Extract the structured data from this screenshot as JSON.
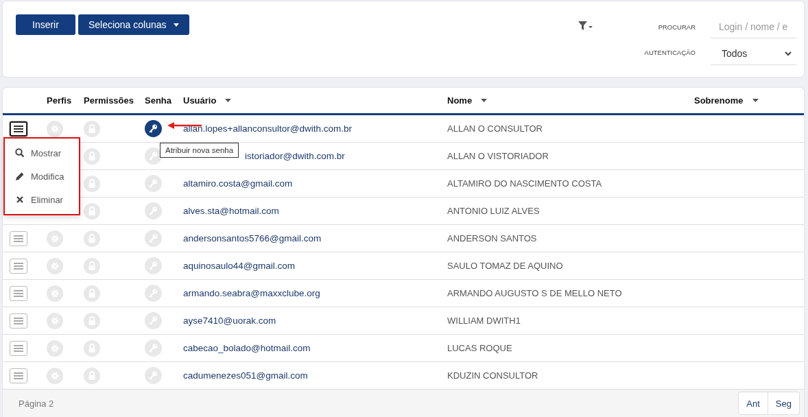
{
  "toolbar": {
    "buttons": [
      {
        "label": "Inserir",
        "kind": "plain"
      },
      {
        "label": "Seleciona colunas",
        "kind": "dropdown"
      }
    ],
    "filters": [
      {
        "label": "PROCURAR",
        "kind": "text",
        "placeholder": "Login / nome / e"
      },
      {
        "label": "AUTENTICAÇÃO",
        "kind": "select",
        "value": "Todos"
      }
    ]
  },
  "table": {
    "columns": [
      {
        "label": "Perfis",
        "sortable": false
      },
      {
        "label": "Permissões",
        "sortable": false
      },
      {
        "label": "Senha",
        "sortable": false
      },
      {
        "label": "Usuário",
        "sortable": true
      },
      {
        "label": "Nome",
        "sortable": true
      },
      {
        "label": "Sobrenome",
        "sortable": true
      }
    ],
    "rows": [
      {
        "usuario": "allan.lopes+allanconsultor@dwith.com.br",
        "nome": "ALLAN O CONSULTOR",
        "key_highlighted": true,
        "key_tooltip": "Atribuir nova senha",
        "row_menu": [
          {
            "label": "Mostrar",
            "kind": "view"
          },
          {
            "label": "Modifica",
            "kind": "edit"
          },
          {
            "label": "Eliminar",
            "kind": "delete"
          }
        ]
      },
      {
        "usuario": "istoriador@dwith.com.br",
        "nome": "ALLAN O VISTORIADOR",
        "key_highlighted": false
      },
      {
        "usuario": "altamiro.costa@gmail.com",
        "nome": "ALTAMIRO DO NASCIMENTO COSTA",
        "key_highlighted": false
      },
      {
        "usuario": "alves.sta@hotmail.com",
        "nome": "ANTONIO LUIZ ALVES",
        "key_highlighted": false
      },
      {
        "usuario": "andersonsantos5766@gmail.com",
        "nome": "ANDERSON SANTOS",
        "key_highlighted": false
      },
      {
        "usuario": "aquinosaulo44@gmail.com",
        "nome": "SAULO TOMAZ DE AQUINO",
        "key_highlighted": false
      },
      {
        "usuario": "armando.seabra@maxxclube.org",
        "nome": "ARMANDO AUGUSTO S DE MELLO NETO",
        "key_highlighted": false
      },
      {
        "usuario": "ayse7410@uorak.com",
        "nome": "WILLIAM DWITH1",
        "key_highlighted": false
      },
      {
        "usuario": "cabecao_bolado@hotmail.com",
        "nome": "LUCAS ROQUE",
        "key_highlighted": false
      },
      {
        "usuario": "cadumenezes051@gmail.com",
        "nome": "KDUZIN CONSULTOR",
        "key_highlighted": false
      }
    ]
  },
  "footer": {
    "page": "Página 2",
    "buttons": [
      "Ant",
      "Seg"
    ]
  }
}
